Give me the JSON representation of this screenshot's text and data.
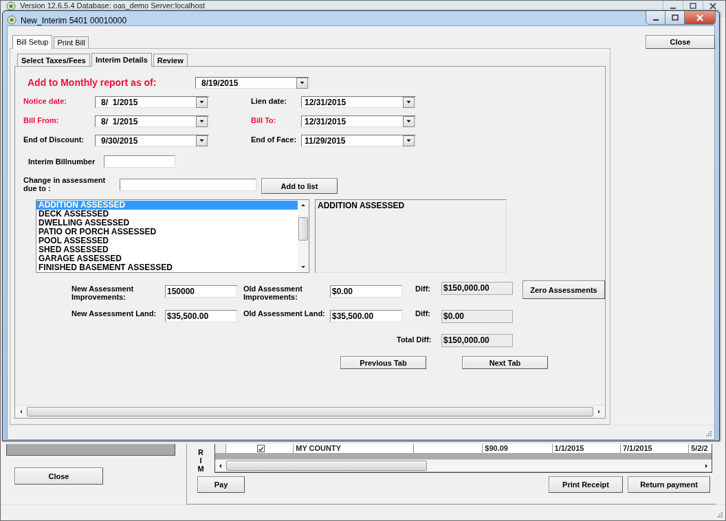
{
  "background_window": {
    "title": "Version 12.6.5.4 Database: oas_demo Server:localhost",
    "close_button": "Close",
    "side_letters": [
      "R",
      "I",
      "M"
    ],
    "grid_row": {
      "checked": true,
      "cells": [
        "MY COUNTY",
        "",
        "$90.09",
        "1/1/2015",
        "7/1/2015",
        "5/2/2"
      ]
    },
    "pay_button": "Pay",
    "buttons": [
      "Print Receipt",
      "Return payment"
    ]
  },
  "dialog": {
    "title": "New_Interim 5401 00010000",
    "close_button": "Close"
  },
  "outer_tabs": [
    {
      "label": "Bill Setup",
      "selected": true
    },
    {
      "label": "Print Bill",
      "selected": false
    }
  ],
  "inner_tabs": [
    {
      "label": "Select Taxes/Fees",
      "selected": false
    },
    {
      "label": "Interim Details",
      "selected": true
    },
    {
      "label": "Review",
      "selected": false
    }
  ],
  "monthly_report": {
    "label": "Add to Monthly report as of:",
    "value": "8/19/2015"
  },
  "date_rows": [
    [
      {
        "label": "Notice date:",
        "value": "8/  1/2015",
        "required": true
      },
      {
        "label": "Lien date:",
        "value": "12/31/2015",
        "required": false
      }
    ],
    [
      {
        "label": "Bill From:",
        "value": "8/  1/2015",
        "required": true
      },
      {
        "label": "Bill To:",
        "value": "12/31/2015",
        "required": true
      }
    ],
    [
      {
        "label": "End of Discount:",
        "value": "9/30/2015",
        "required": false
      },
      {
        "label": "End of Face:",
        "value": "11/29/2015",
        "required": false
      }
    ]
  ],
  "billnumber": {
    "label": "Interim Billnumber"
  },
  "change_reason": {
    "label": "Change in assessment due to :",
    "add_button": "Add to list"
  },
  "reasons": [
    {
      "text": "ADDITION ASSESSED",
      "selected": true
    },
    {
      "text": "DECK ASSESSED",
      "selected": false
    },
    {
      "text": "DWELLING ASSESSED",
      "selected": false
    },
    {
      "text": "PATIO OR PORCH ASSESSED",
      "selected": false
    },
    {
      "text": "POOL ASSESSED",
      "selected": false
    },
    {
      "text": "SHED ASSESSED",
      "selected": false
    },
    {
      "text": "GARAGE ASSESSED",
      "selected": false
    },
    {
      "text": "FINISHED BASEMENT ASSESSED",
      "selected": false
    }
  ],
  "chosen_reasons": [
    "ADDITION ASSESSED"
  ],
  "assessment_rows": [
    {
      "new_label": "New Assessment Improvements:",
      "new_value": "150000",
      "old_label": "Old Assessment Improvements:",
      "old_value": "$0.00",
      "diff_label": "Diff:",
      "diff_value": "$150,000.00"
    },
    {
      "new_label": "New Assessment Land:",
      "new_value": "$35,500.00",
      "old_label": "Old Assessment Land:",
      "old_value": "$35,500.00",
      "diff_label": "Diff:",
      "diff_value": "$0.00"
    }
  ],
  "zero_button": "Zero Assessments",
  "total": {
    "label": "Total Diff:",
    "value": "$150,000.00"
  },
  "nav_buttons": [
    "Previous Tab",
    "Next Tab"
  ]
}
